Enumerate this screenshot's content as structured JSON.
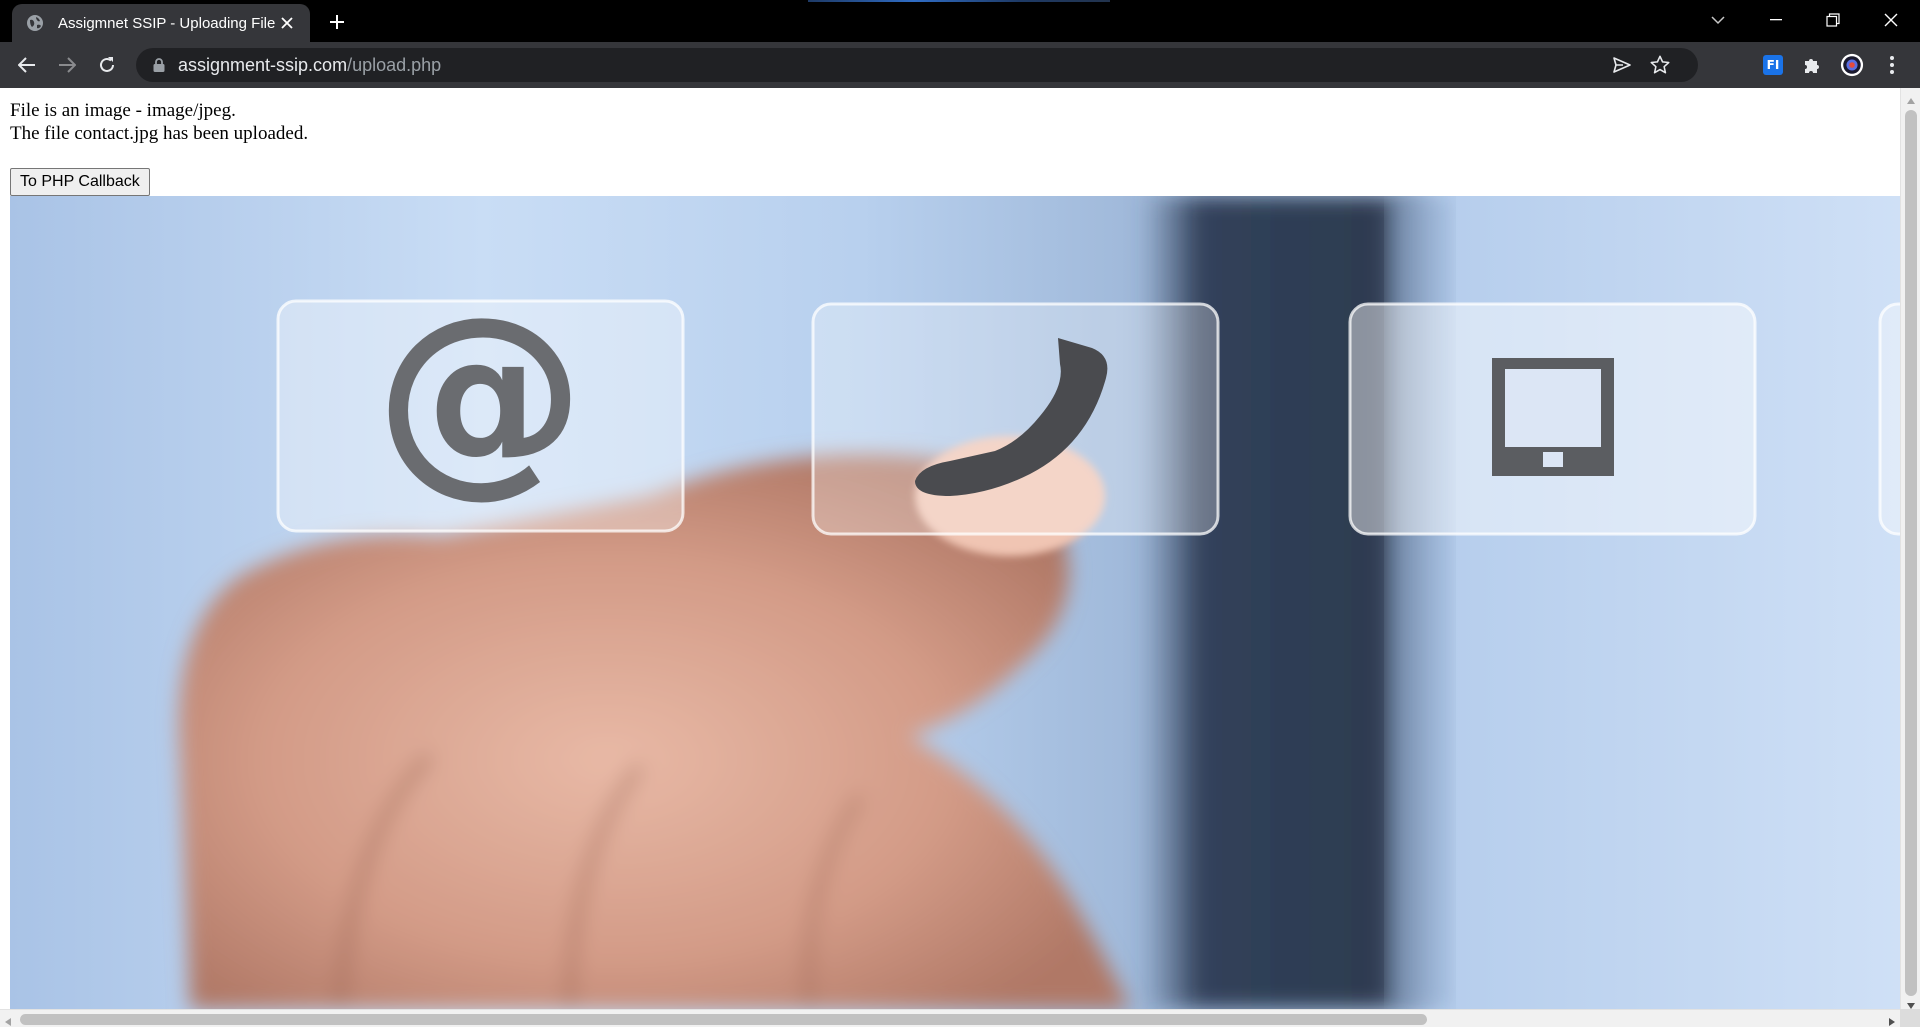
{
  "browser": {
    "tab": {
      "title": "Assigmnet SSIP - Uploading File",
      "favicon": "globe-icon"
    },
    "address_bar": {
      "host": "assignment-ssip.com",
      "path": "/upload.php"
    },
    "window_controls": [
      "tab-search-icon",
      "minimize-icon",
      "restore-icon",
      "close-icon"
    ],
    "extensions": {
      "fi_label": "FI"
    },
    "theme": {
      "tabstrip_bg": "#000000",
      "toolbar_bg": "#35363a",
      "omnibox_bg": "#202124",
      "text": "#e8eaed",
      "muted": "#9aa0a6"
    }
  },
  "page": {
    "messages": [
      "File is an image - image/jpeg.",
      "The file contact.jpg has been uploaded."
    ],
    "callback_button_label": "To PHP Callback",
    "image": {
      "description_icons": [
        "at-sign-icon",
        "phone-handset-icon",
        "tablet-icon"
      ],
      "main_colors": [
        "#bfd4ef",
        "#2c3a52",
        "#d9a48f"
      ]
    }
  }
}
